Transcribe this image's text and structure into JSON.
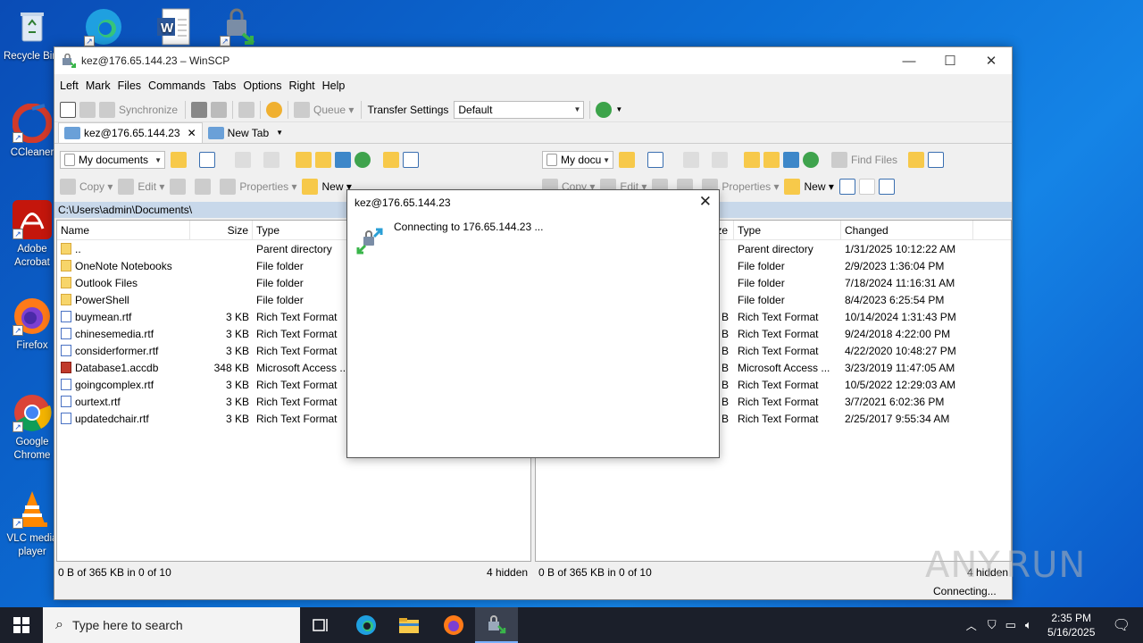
{
  "desktop": {
    "icons": [
      {
        "label": "Recycle Bin",
        "icon": "recycle-bin-icon"
      },
      {
        "label": "CCleaner",
        "icon": "ccleaner-icon"
      },
      {
        "label": "Adobe Acrobat",
        "icon": "adobe-acrobat-icon"
      },
      {
        "label": "Firefox",
        "icon": "firefox-icon"
      },
      {
        "label": "Google Chrome",
        "icon": "chrome-icon"
      },
      {
        "label": "VLC media player",
        "icon": "vlc-icon"
      }
    ]
  },
  "window": {
    "title": "kez@176.65.144.23 – WinSCP",
    "menu": [
      "Left",
      "Mark",
      "Files",
      "Commands",
      "Tabs",
      "Options",
      "Right",
      "Help"
    ],
    "toolbar": {
      "synchronize": "Synchronize",
      "queue": "Queue",
      "transfer_settings_label": "Transfer Settings",
      "transfer_settings_value": "Default"
    },
    "tabs": {
      "session": "kez@176.65.144.23",
      "new_tab": "New Tab"
    },
    "left_panel": {
      "location": "My documents",
      "path": "C:\\Users\\admin\\Documents\\",
      "actions": {
        "copy": "Copy",
        "edit": "Edit",
        "properties": "Properties",
        "new": "New"
      },
      "columns": [
        "Name",
        "Size",
        "Type"
      ],
      "files": [
        {
          "name": "..",
          "size": "",
          "type": "Parent directory",
          "icon": "up"
        },
        {
          "name": "OneNote Notebooks",
          "size": "",
          "type": "File folder",
          "icon": "folder"
        },
        {
          "name": "Outlook Files",
          "size": "",
          "type": "File folder",
          "icon": "folder"
        },
        {
          "name": "PowerShell",
          "size": "",
          "type": "File folder",
          "icon": "folder"
        },
        {
          "name": "buymean.rtf",
          "size": "3 KB",
          "type": "Rich Text Format",
          "icon": "rtf"
        },
        {
          "name": "chinesemedia.rtf",
          "size": "3 KB",
          "type": "Rich Text Format",
          "icon": "rtf"
        },
        {
          "name": "considerformer.rtf",
          "size": "3 KB",
          "type": "Rich Text Format",
          "icon": "rtf"
        },
        {
          "name": "Database1.accdb",
          "size": "348 KB",
          "type": "Microsoft Access ...",
          "icon": "accdb"
        },
        {
          "name": "goingcomplex.rtf",
          "size": "3 KB",
          "type": "Rich Text Format",
          "icon": "rtf"
        },
        {
          "name": "ourtext.rtf",
          "size": "3 KB",
          "type": "Rich Text Format",
          "icon": "rtf"
        },
        {
          "name": "updatedchair.rtf",
          "size": "3 KB",
          "type": "Rich Text Format",
          "icon": "rtf"
        }
      ],
      "status": "0 B of 365 KB in 0 of 10",
      "hidden": "4 hidden"
    },
    "right_panel": {
      "location": "My docu",
      "find_files": "Find Files",
      "actions": {
        "copy": "Copy",
        "edit": "Edit",
        "properties": "Properties",
        "new": "New"
      },
      "columns": [
        "ze",
        "Type",
        "Changed"
      ],
      "files": [
        {
          "size": "",
          "type": "Parent directory",
          "changed": "1/31/2025 10:12:22 AM"
        },
        {
          "size": "",
          "type": "File folder",
          "changed": "2/9/2023 1:36:04 PM"
        },
        {
          "size": "",
          "type": "File folder",
          "changed": "7/18/2024 11:16:31 AM"
        },
        {
          "size": "",
          "type": "File folder",
          "changed": "8/4/2023 6:25:54 PM"
        },
        {
          "size": "B",
          "type": "Rich Text Format",
          "changed": "10/14/2024 1:31:43 PM"
        },
        {
          "size": "B",
          "type": "Rich Text Format",
          "changed": "9/24/2018 4:22:00 PM"
        },
        {
          "size": "B",
          "type": "Rich Text Format",
          "changed": "4/22/2020 10:48:27 PM"
        },
        {
          "size": "B",
          "type": "Microsoft Access ...",
          "changed": "3/23/2019 11:47:05 AM"
        },
        {
          "size": "B",
          "type": "Rich Text Format",
          "changed": "10/5/2022 12:29:03 AM"
        },
        {
          "size": "B",
          "type": "Rich Text Format",
          "changed": "3/7/2021 6:02:36 PM"
        },
        {
          "size": "B",
          "type": "Rich Text Format",
          "changed": "2/25/2017 9:55:34 AM"
        }
      ],
      "status": "0 B of 365 KB in 0 of 10",
      "hidden": "4 hidden"
    },
    "bottom_status": "Connecting..."
  },
  "dialog": {
    "title": "kez@176.65.144.23",
    "message": "Connecting to 176.65.144.23 ..."
  },
  "taskbar": {
    "search_placeholder": "Type here to search",
    "time": "2:35 PM",
    "date": "5/16/2025"
  },
  "watermark": "ANY.RUN"
}
